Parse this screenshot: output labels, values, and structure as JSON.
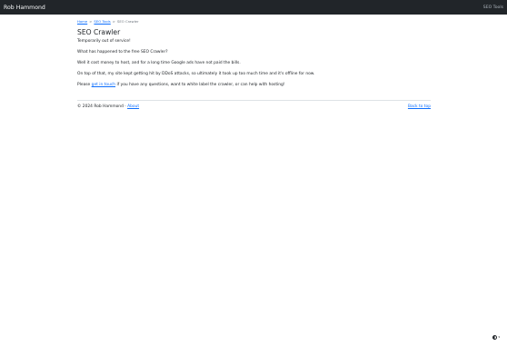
{
  "navbar": {
    "brand": "Rob Hammond",
    "link": "SEO Tools"
  },
  "breadcrumb": {
    "home": "Home",
    "separator": ">",
    "seo_tools": "SEO Tools",
    "current": "SEO Crawler"
  },
  "page": {
    "title": "SEO Crawler",
    "p1": "Temporarily out of service!",
    "p2": "What has happened to the free SEO Crawler?",
    "p3": "Well it cost money to host, and for a long time Google ads have not paid the bills.",
    "p4": "On top of that, my site kept getting hit by DDoS attacks, so ultimately it took up too much time and it's offline for now.",
    "p5_before": "Please ",
    "p5_link": "get in touch",
    "p5_after": " if you have any questions, want to white label the crawler, or can help with hosting!"
  },
  "footer": {
    "copyright": "© 2024 Rob Hammond · ",
    "about": "About",
    "back_to_top": "Back to top"
  },
  "theme_toggle": {
    "icon": "half-circle-contrast-icon",
    "caret": "▾"
  }
}
